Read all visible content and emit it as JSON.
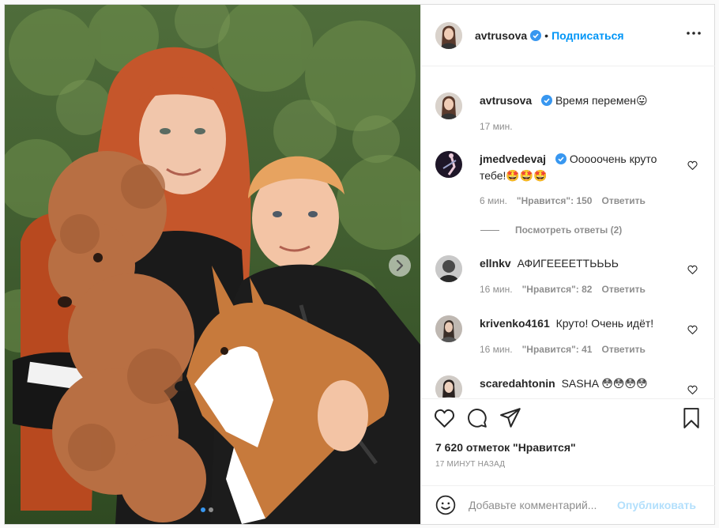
{
  "header": {
    "username": "avtrusova",
    "separator": "•",
    "follow_label": "Подписаться",
    "more_icon": "more-horizontal-icon"
  },
  "caption": {
    "username": "avtrusova",
    "text": "Время перемен",
    "emoji": "😛",
    "time": "17 мин."
  },
  "comments": [
    {
      "username": "jmedvedevaj",
      "verified": true,
      "text": "Ооооочень круто тебе!",
      "emojis": [
        "🤩",
        "🤩",
        "🤩"
      ],
      "time": "6 мин.",
      "likes": "\"Нравится\": 150",
      "reply": "Ответить"
    },
    {
      "username": "ellnkv",
      "verified": false,
      "text": "АФИГЕЕЕЕТТЬЬЬЬ",
      "time": "16 мин.",
      "likes": "\"Нравится\": 82",
      "reply": "Ответить"
    },
    {
      "username": "krivenko4161",
      "verified": false,
      "text": "Круто! Очень идёт!",
      "time": "16 мин.",
      "likes": "\"Нравится\": 41",
      "reply": "Ответить"
    },
    {
      "username": "scaredahtonin",
      "verified": false,
      "text": "SASHA",
      "emojis": [
        "😳",
        "😳",
        "😳",
        "😳"
      ]
    }
  ],
  "view_replies": "Посмотреть ответы (2)",
  "actions": {
    "icons": [
      "heart-icon",
      "comment-icon",
      "share-icon",
      "bookmark-icon"
    ],
    "likes": "7 620 отметок \"Нравится\"",
    "posted": "17 МИНУТ НАЗАД"
  },
  "add_comment": {
    "placeholder": "Добавьте комментарий...",
    "publish_label": "Опубликовать",
    "emoji_icon": "smiley-icon"
  },
  "colors": {
    "link": "#0095f6",
    "publish_disabled": "#b2dffc",
    "verified": "#3897f0",
    "muted": "#8e8e8e"
  }
}
